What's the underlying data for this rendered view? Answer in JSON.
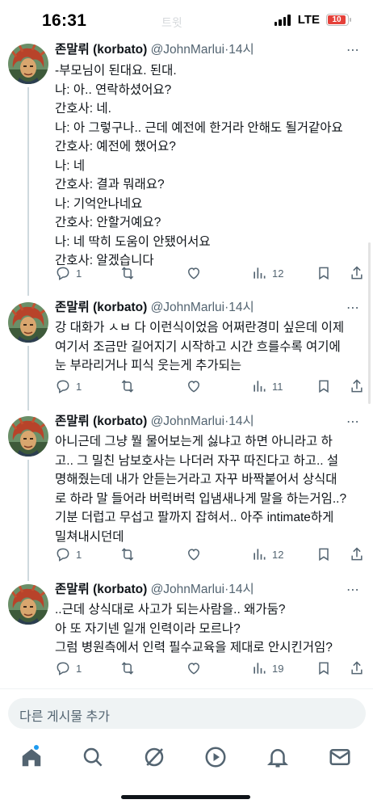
{
  "status": {
    "time": "16:31",
    "network": "LTE",
    "battery": "10"
  },
  "header_faded": "트윗",
  "tweets": [
    {
      "name": "존말뤼 (korbato)",
      "handle": "@JohnMarlui",
      "time": "14시",
      "lines": [
        "-부모님이 된대요. 된대.",
        "나: 아.. 연락하셨어요?",
        "간호사: 네.",
        "나: 아 그렇구나.. 근데 예전에 한거라 안해도 될거같아요",
        "간호사: 예전에 했어요?",
        "나: 네",
        "간호사: 결과 뭐래요?",
        "나: 기억안나네요",
        "간호사: 안할거예요?",
        "나: 네 딱히 도움이 안됐어서요",
        "간호사: 알겠습니다"
      ],
      "replies": "1",
      "retweets": "",
      "likes": "",
      "views": "12"
    },
    {
      "name": "존말뤼 (korbato)",
      "handle": "@JohnMarlui",
      "time": "14시",
      "lines": [
        "강 대화가 ㅅㅂ 다 이런식이었음 어쩌란경미 싶은데 이제",
        "여기서 조금만 길어지기 시작하고 시간 흐를수록 여기에",
        "눈 부라리거나 피식 웃는게 추가되는"
      ],
      "replies": "1",
      "retweets": "",
      "likes": "",
      "views": "11"
    },
    {
      "name": "존말뤼 (korbato)",
      "handle": "@JohnMarlui",
      "time": "14시",
      "lines": [
        "아니근데 그냥 뭘 물어보는게 싫냐고 하면 아니라고 하",
        "고.. 그 밀친 남보호사는 나더러 자꾸 따진다고 하고.. 설",
        "명해줬는데 내가 안듣는거라고 자꾸 바짝붙어서 상식대",
        "로 하라 말 들어라 버럭버럭 입냄새나게 말을 하는거임..?",
        "기분 더럽고 무섭고 팔까지 잡혀서.. 아주 intimate하게",
        "밀쳐내시던데"
      ],
      "replies": "1",
      "retweets": "",
      "likes": "",
      "views": "12"
    },
    {
      "name": "존말뤼 (korbato)",
      "handle": "@JohnMarlui",
      "time": "14시",
      "lines": [
        "..근데 상식대로 사고가 되는사람을.. 왜가둠?",
        "아 또 자기넨 일개 인력이라 모르나?",
        "그럼 병원측에서 인력 필수교육을 제대로 안시킨거임?"
      ],
      "replies": "1",
      "retweets": "",
      "likes": "",
      "views": "19"
    }
  ],
  "reply_placeholder": "다른 게시물 추가",
  "tabs": [
    "home",
    "search",
    "grok",
    "video",
    "notifications",
    "messages"
  ]
}
